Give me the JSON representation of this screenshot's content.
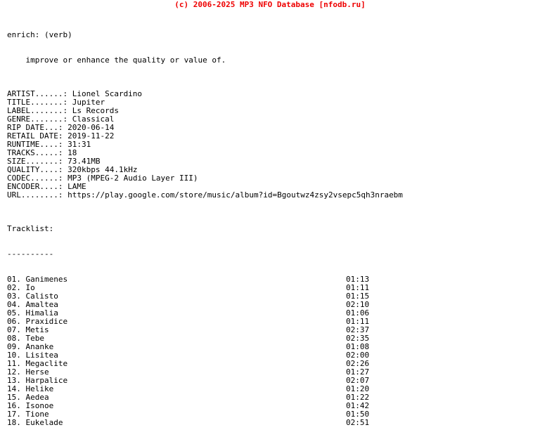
{
  "header": {
    "copyright_line": "(c) 2006-2025 MP3 NFO Database [nfodb.ru]",
    "color": "#ee0000"
  },
  "definition": {
    "term_line": "enrich: (verb)",
    "meaning_line": "    improve or enhance the quality or value of."
  },
  "release_info": {
    "fields": [
      {
        "label": "ARTIST......:",
        "value": "Lionel Scardino"
      },
      {
        "label": "TITLE.......:",
        "value": "Jupiter"
      },
      {
        "label": "LABEL.......:",
        "value": "Ls Records"
      },
      {
        "label": "GENRE.......:",
        "value": "Classical"
      },
      {
        "label": "RIP DATE...:",
        "value": "2020-06-14"
      },
      {
        "label": "RETAIL DATE:",
        "value": "2019-11-22"
      },
      {
        "label": "RUNTIME....:",
        "value": "31:31"
      },
      {
        "label": "TRACKS.....:",
        "value": "18"
      },
      {
        "label": "SIZE.......:",
        "value": "73.41MB"
      },
      {
        "label": "QUALITY....:",
        "value": "320kbps 44.1kHz"
      },
      {
        "label": "CODEC......:",
        "value": "MP3 (MPEG-2 Audio Layer III)"
      },
      {
        "label": "ENCODER....:",
        "value": "LAME"
      },
      {
        "label": "URL........:",
        "value": "https://play.google.com/store/music/album?id=Bgoutwz4zsy2vsepc5qh3nraebm"
      }
    ]
  },
  "tracklist": {
    "heading": "Tracklist:",
    "rule": "----------",
    "tracks": [
      {
        "num": "01.",
        "title": "Ganimenes",
        "time": "01:13"
      },
      {
        "num": "02.",
        "title": "Io",
        "time": "01:11"
      },
      {
        "num": "03.",
        "title": "Calisto",
        "time": "01:15"
      },
      {
        "num": "04.",
        "title": "Amaltea",
        "time": "02:10"
      },
      {
        "num": "05.",
        "title": "Himalia",
        "time": "01:06"
      },
      {
        "num": "06.",
        "title": "Praxidice",
        "time": "01:11"
      },
      {
        "num": "07.",
        "title": "Metis",
        "time": "02:37"
      },
      {
        "num": "08.",
        "title": "Tebe",
        "time": "02:35"
      },
      {
        "num": "09.",
        "title": "Ananke",
        "time": "01:08"
      },
      {
        "num": "10.",
        "title": "Lisitea",
        "time": "02:00"
      },
      {
        "num": "11.",
        "title": "Megaclite",
        "time": "02:26"
      },
      {
        "num": "12.",
        "title": "Herse",
        "time": "01:27"
      },
      {
        "num": "13.",
        "title": "Harpalice",
        "time": "02:07"
      },
      {
        "num": "14.",
        "title": "Helike",
        "time": "01:20"
      },
      {
        "num": "15.",
        "title": "Aedea",
        "time": "01:22"
      },
      {
        "num": "16.",
        "title": "Isonoe",
        "time": "01:42"
      },
      {
        "num": "17.",
        "title": "Tione",
        "time": "01:50"
      },
      {
        "num": "18.",
        "title": "Eukelade",
        "time": "02:51"
      }
    ]
  }
}
